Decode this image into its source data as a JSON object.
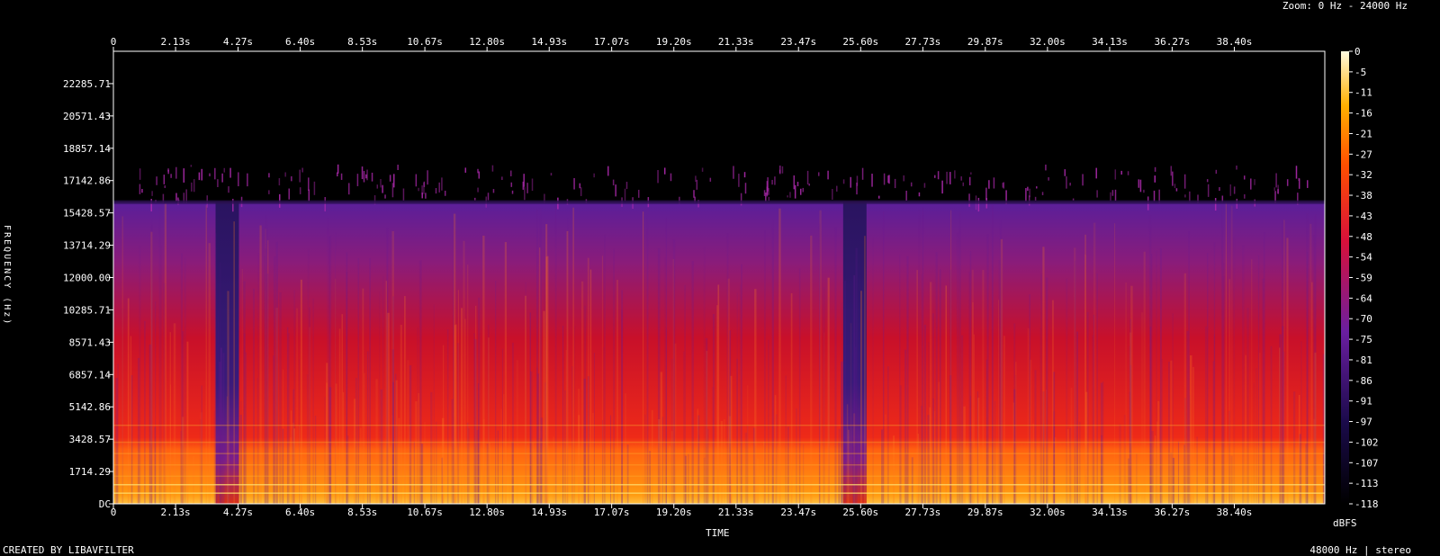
{
  "header": {
    "zoom": "Zoom: 0 Hz - 24000 Hz"
  },
  "footer": {
    "created": "CREATED BY LIBAVFILTER",
    "rate": "48000 Hz | stereo"
  },
  "chart_data": {
    "type": "heatmap",
    "title": "",
    "xlabel": "TIME",
    "ylabel": "FREQUENCY (Hz)",
    "colorbar_label": "dBFS",
    "x_tick_labels": [
      "0",
      "2.13s",
      "4.27s",
      "6.40s",
      "8.53s",
      "10.67s",
      "12.80s",
      "14.93s",
      "17.07s",
      "19.20s",
      "21.33s",
      "23.47s",
      "25.60s",
      "27.73s",
      "29.87s",
      "32.00s",
      "34.13s",
      "36.27s",
      "38.40s"
    ],
    "x_ticks_seconds": [
      0,
      2.13,
      4.27,
      6.4,
      8.53,
      10.67,
      12.8,
      14.93,
      17.07,
      19.2,
      21.33,
      23.47,
      25.6,
      27.73,
      29.87,
      32.0,
      34.13,
      36.27,
      38.4
    ],
    "xlim": [
      0,
      41.5
    ],
    "y_tick_labels": [
      "DC",
      "1714.29",
      "3428.57",
      "5142.86",
      "6857.14",
      "8571.43",
      "10285.71",
      "12000.00",
      "13714.29",
      "15428.57",
      "17142.86",
      "18857.14",
      "20571.43",
      "22285.71"
    ],
    "y_ticks_hz": [
      0,
      1714.29,
      3428.57,
      5142.86,
      6857.14,
      8571.43,
      10285.71,
      12000.0,
      13714.29,
      15428.57,
      17142.86,
      18857.14,
      20571.43,
      22285.71
    ],
    "ylim": [
      0,
      24000
    ],
    "colorbar_ticks": [
      "0",
      "-5",
      "-11",
      "-16",
      "-21",
      "-27",
      "-32",
      "-38",
      "-43",
      "-48",
      "-54",
      "-59",
      "-64",
      "-70",
      "-75",
      "-81",
      "-86",
      "-91",
      "-97",
      "-102",
      "-107",
      "-113",
      "-118"
    ],
    "colorbar_range_dbfs": [
      -118,
      0
    ],
    "colors": {
      "low": "#000000",
      "mid_low": "#5a1f9a",
      "mid": "#e0102a",
      "high": "#ffb000",
      "peak": "#fffbe0"
    },
    "lowpass_cutoff_hz": 16000,
    "quiet_segments_seconds": [
      [
        3.5,
        4.3
      ],
      [
        25.0,
        25.8
      ]
    ]
  }
}
